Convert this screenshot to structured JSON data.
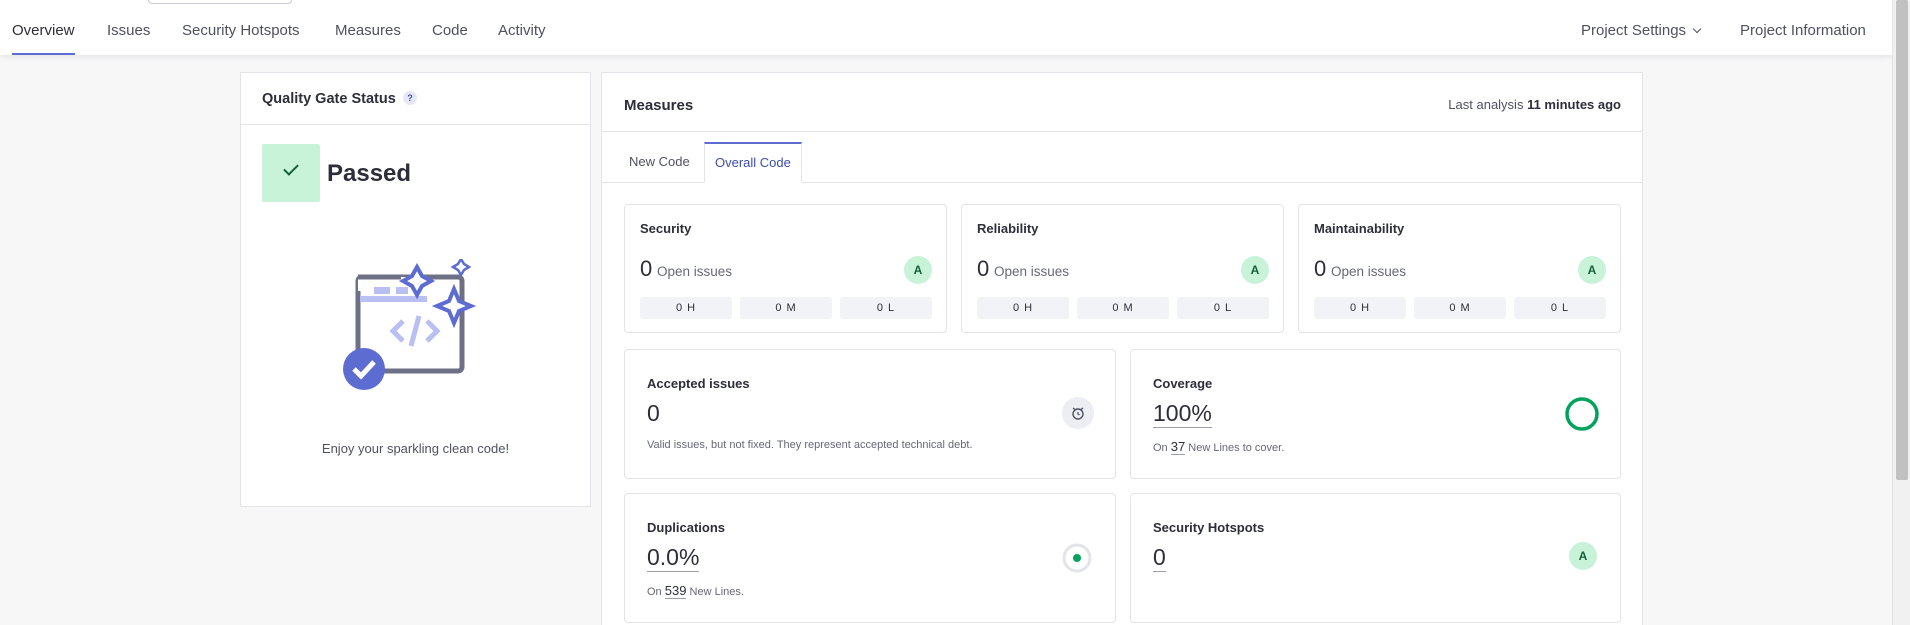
{
  "nav": {
    "items": [
      "Overview",
      "Issues",
      "Security Hotspots",
      "Measures",
      "Code",
      "Activity"
    ],
    "project_settings": "Project Settings",
    "project_information": "Project Information"
  },
  "quality_gate": {
    "title": "Quality Gate Status",
    "help": "?",
    "status": "Passed",
    "message": "Enjoy your sparkling clean code!"
  },
  "measures": {
    "title": "Measures",
    "last_analysis_label": "Last analysis",
    "last_analysis_value": "11 minutes ago",
    "tabs": [
      "New Code",
      "Overall Code"
    ],
    "active_tab": "Overall Code",
    "open_issues_label": "Open issues",
    "categories": [
      {
        "title": "Security",
        "count": "0",
        "grade": "A",
        "high": "0 H",
        "medium": "0 M",
        "low": "0 L"
      },
      {
        "title": "Reliability",
        "count": "0",
        "grade": "A",
        "high": "0 H",
        "medium": "0 M",
        "low": "0 L"
      },
      {
        "title": "Maintainability",
        "count": "0",
        "grade": "A",
        "high": "0 H",
        "medium": "0 M",
        "low": "0 L"
      }
    ],
    "accepted": {
      "title": "Accepted issues",
      "value": "0",
      "description": "Valid issues, but not fixed. They represent accepted technical debt."
    },
    "coverage": {
      "title": "Coverage",
      "value": "100%",
      "prefix": "On",
      "lines": "37",
      "suffix": "New Lines to cover.",
      "percent": 100
    },
    "duplications": {
      "title": "Duplications",
      "value": "0.0%",
      "prefix": "On",
      "lines": "539",
      "suffix": "New Lines.",
      "percent": 0
    },
    "hotspots": {
      "title": "Security Hotspots",
      "value": "0",
      "grade": "A"
    }
  },
  "colors": {
    "accent": "#5d6cd0",
    "success": "#14613a",
    "success_bg": "#c8f3d8",
    "coverage_ring": "#01a35c"
  }
}
